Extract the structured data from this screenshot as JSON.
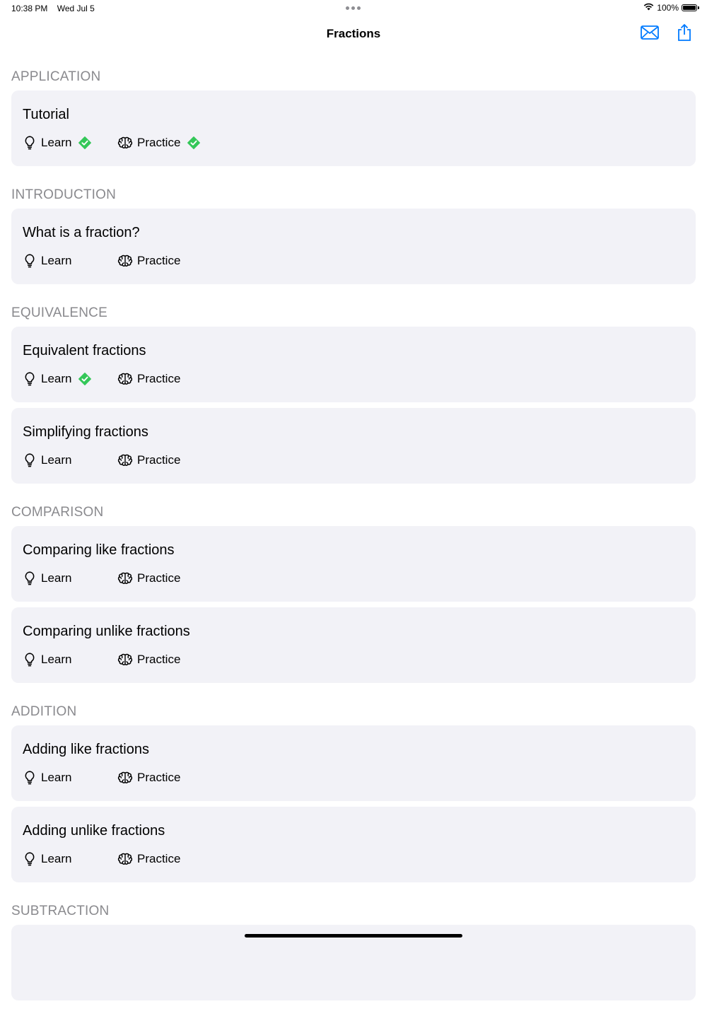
{
  "status": {
    "time": "10:38 PM",
    "date": "Wed Jul 5",
    "battery": "100%"
  },
  "nav": {
    "title": "Fractions"
  },
  "colors": {
    "accent": "#007aff",
    "check": "#34c759",
    "card": "#f2f2f7",
    "header": "#8a8a8e"
  },
  "labels": {
    "learn": "Learn",
    "practice": "Practice"
  },
  "sections": [
    {
      "header": "APPLICATION",
      "cards": [
        {
          "title": "Tutorial",
          "learn_done": true,
          "practice_done": true
        }
      ]
    },
    {
      "header": "INTRODUCTION",
      "cards": [
        {
          "title": "What is a fraction?",
          "learn_done": false,
          "practice_done": false
        }
      ]
    },
    {
      "header": "EQUIVALENCE",
      "cards": [
        {
          "title": "Equivalent fractions",
          "learn_done": true,
          "practice_done": false
        },
        {
          "title": "Simplifying fractions",
          "learn_done": false,
          "practice_done": false
        }
      ]
    },
    {
      "header": "COMPARISON",
      "cards": [
        {
          "title": "Comparing like fractions",
          "learn_done": false,
          "practice_done": false
        },
        {
          "title": "Comparing unlike fractions",
          "learn_done": false,
          "practice_done": false
        }
      ]
    },
    {
      "header": "ADDITION",
      "cards": [
        {
          "title": "Adding like fractions",
          "learn_done": false,
          "practice_done": false
        },
        {
          "title": "Adding unlike fractions",
          "learn_done": false,
          "practice_done": false
        }
      ]
    },
    {
      "header": "SUBTRACTION",
      "cards": [
        {
          "title": "",
          "learn_done": false,
          "practice_done": false
        }
      ]
    }
  ]
}
